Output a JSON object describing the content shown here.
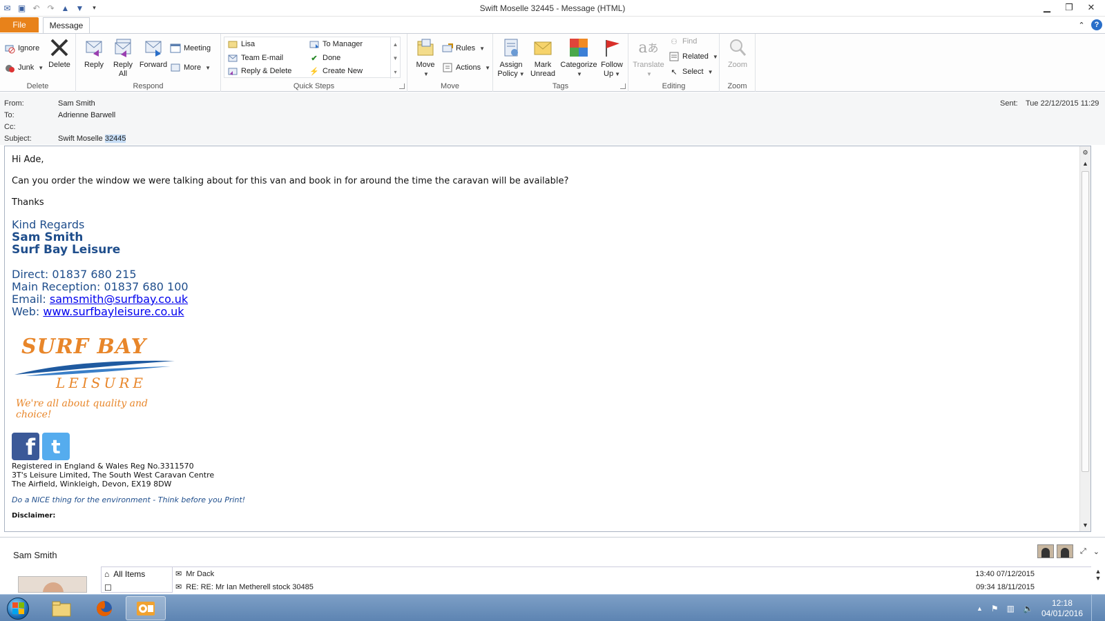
{
  "window": {
    "title": "Swift Moselle 32445  -  Message (HTML)"
  },
  "tabs": {
    "file": "File",
    "message": "Message"
  },
  "ribbon": {
    "delete_group": {
      "label": "Delete",
      "ignore": "Ignore",
      "junk": "Junk",
      "delete": "Delete"
    },
    "respond_group": {
      "label": "Respond",
      "reply": "Reply",
      "reply_all_1": "Reply",
      "reply_all_2": "All",
      "forward": "Forward",
      "meeting": "Meeting",
      "more": "More"
    },
    "quick_steps_group": {
      "label": "Quick Steps",
      "items": [
        "Lisa",
        "Team E-mail",
        "Reply & Delete",
        "To Manager",
        "Done",
        "Create New"
      ]
    },
    "move_group": {
      "label": "Move",
      "move": "Move",
      "rules": "Rules",
      "actions": "Actions"
    },
    "tags_group": {
      "label": "Tags",
      "assign_1": "Assign",
      "assign_2": "Policy",
      "mark_1": "Mark",
      "mark_2": "Unread",
      "categorize": "Categorize",
      "follow_1": "Follow",
      "follow_2": "Up"
    },
    "editing_group": {
      "label": "Editing",
      "translate": "Translate",
      "find": "Find",
      "related": "Related",
      "select": "Select"
    },
    "zoom_group": {
      "label": "Zoom",
      "zoom": "Zoom"
    }
  },
  "header": {
    "from_label": "From:",
    "from": "Sam Smith",
    "to_label": "To:",
    "to": "Adrienne Barwell",
    "cc_label": "Cc:",
    "subject_label": "Subject:",
    "subject_prefix": "Swift Moselle",
    "subject_selected": "32445",
    "sent_label": "Sent:",
    "sent": "Tue 22/12/2015 11:29"
  },
  "body": {
    "greeting": "Hi Ade,",
    "message": "Can you order the window we were talking about for this van and book in for around the time the caravan will be available?",
    "thanks": "Thanks",
    "kind_regards": "Kind Regards",
    "name": "Sam Smith",
    "company": "Surf Bay Leisure",
    "direct": "Direct:  01837 680 215",
    "reception": "Main Reception:  01837 680 100",
    "email_label": "Email:",
    "email": "samsmith@surfbay.co.uk",
    "web_label": "Web:",
    "web": "www.surfbayleisure.co.uk",
    "logo_line1": "SURF BAY",
    "logo_line2": "LEISURE",
    "logo_tagline": "We're all about quality and choice!",
    "reg_1": "Registered in England & Wales Reg No.3311570",
    "reg_2": "3T's Leisure Limited, The South West Caravan Centre",
    "reg_3": "The Airfield, Winkleigh, Devon, EX19 8DW",
    "env": "Do a NICE thing for the environment - Think before you Print!",
    "disclaimer": "Disclaimer:"
  },
  "people_pane": {
    "name": "Sam Smith",
    "folder_all": "All Items",
    "mail": [
      {
        "subject": "Mr Dack",
        "date": "13:40  07/12/2015"
      },
      {
        "subject": "RE: RE: Mr Ian Metherell stock 30485",
        "date": "09:34  18/11/2015"
      }
    ]
  },
  "taskbar": {
    "time": "12:18",
    "date": "04/01/2016"
  },
  "colors": {
    "file_tab": "#e8821a",
    "signature": "#1f4e8c",
    "logo": "#e8862a",
    "taskbar": "#6d92bd"
  }
}
